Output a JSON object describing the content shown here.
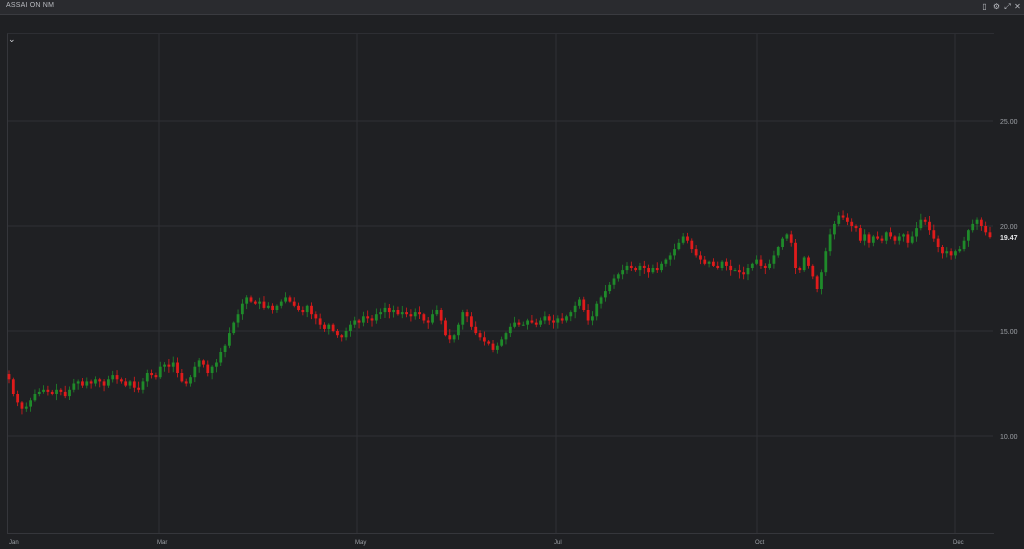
{
  "window": {
    "title": "ASSAI ON NM",
    "controls": [
      {
        "name": "restore-icon",
        "glyph": "▯"
      },
      {
        "name": "settings-icon",
        "glyph": "⚙"
      },
      {
        "name": "expand-icon",
        "glyph": "⤢"
      },
      {
        "name": "close-icon",
        "glyph": "✕"
      }
    ]
  },
  "collapse_glyph": "⌄",
  "chart_data": {
    "type": "candlestick",
    "title": "ASSAI ON NM",
    "x_ticks": [
      "Jan",
      "Mar",
      "May",
      "Jul",
      "Oct",
      "Dec"
    ],
    "y_ticks": [
      "10.00",
      "15.00",
      "20.00",
      "25.00"
    ],
    "y_tick_values": [
      10,
      15,
      20,
      25
    ],
    "ylim": [
      5,
      30
    ],
    "last_price_label": "19.47",
    "last_price": 19.47,
    "grid": true,
    "up_color": "#1f8a2a",
    "down_color": "#e01b1b",
    "closes": [
      12.7,
      12.0,
      11.6,
      11.3,
      11.4,
      11.7,
      12.0,
      12.1,
      12.2,
      12.1,
      12.0,
      12.2,
      12.1,
      11.9,
      12.2,
      12.5,
      12.6,
      12.4,
      12.6,
      12.5,
      12.7,
      12.6,
      12.4,
      12.7,
      12.9,
      12.7,
      12.6,
      12.4,
      12.6,
      12.3,
      12.2,
      12.6,
      13.0,
      12.9,
      12.8,
      13.3,
      13.4,
      13.3,
      13.5,
      13.0,
      12.6,
      12.5,
      12.8,
      13.3,
      13.6,
      13.4,
      13.0,
      13.3,
      13.5,
      14.0,
      14.3,
      14.9,
      15.4,
      15.8,
      16.3,
      16.6,
      16.4,
      16.3,
      16.4,
      16.1,
      16.2,
      16.0,
      16.2,
      16.4,
      16.6,
      16.4,
      16.2,
      16.0,
      15.9,
      16.2,
      15.8,
      15.6,
      15.3,
      15.1,
      15.3,
      15.0,
      14.8,
      14.7,
      15.0,
      15.3,
      15.5,
      15.4,
      15.7,
      15.6,
      15.5,
      15.8,
      15.9,
      16.1,
      15.9,
      16.0,
      15.8,
      15.9,
      15.8,
      15.7,
      15.9,
      15.8,
      15.5,
      15.4,
      15.8,
      16.0,
      15.5,
      14.8,
      14.6,
      14.8,
      15.3,
      15.9,
      15.7,
      15.2,
      14.9,
      14.7,
      14.5,
      14.4,
      14.1,
      14.3,
      14.6,
      14.9,
      15.2,
      15.4,
      15.3,
      15.3,
      15.5,
      15.4,
      15.3,
      15.5,
      15.7,
      15.5,
      15.4,
      15.6,
      15.5,
      15.7,
      15.9,
      16.2,
      16.5,
      16.0,
      15.5,
      15.7,
      16.3,
      16.6,
      16.9,
      17.2,
      17.5,
      17.7,
      17.9,
      18.1,
      18.0,
      17.9,
      18.1,
      18.0,
      17.8,
      18.0,
      17.9,
      18.2,
      18.4,
      18.6,
      18.9,
      19.2,
      19.5,
      19.3,
      18.9,
      18.6,
      18.4,
      18.2,
      18.3,
      18.1,
      18.0,
      18.3,
      18.1,
      17.9,
      17.9,
      17.8,
      17.7,
      18.0,
      18.2,
      18.4,
      18.1,
      18.0,
      18.2,
      18.6,
      19.0,
      19.4,
      19.6,
      19.2,
      18.0,
      17.9,
      18.5,
      18.1,
      17.6,
      17.0,
      17.8,
      18.8,
      19.6,
      20.1,
      20.5,
      20.4,
      20.2,
      20.0,
      19.9,
      19.3,
      19.6,
      19.2,
      19.5,
      19.4,
      19.3,
      19.7,
      19.5,
      19.3,
      19.5,
      19.6,
      19.2,
      19.5,
      19.9,
      20.3,
      20.2,
      19.8,
      19.4,
      19.0,
      18.7,
      18.8,
      18.6,
      18.8,
      18.9,
      19.3,
      19.8,
      20.1,
      20.3,
      20.0,
      19.7,
      19.47
    ]
  }
}
